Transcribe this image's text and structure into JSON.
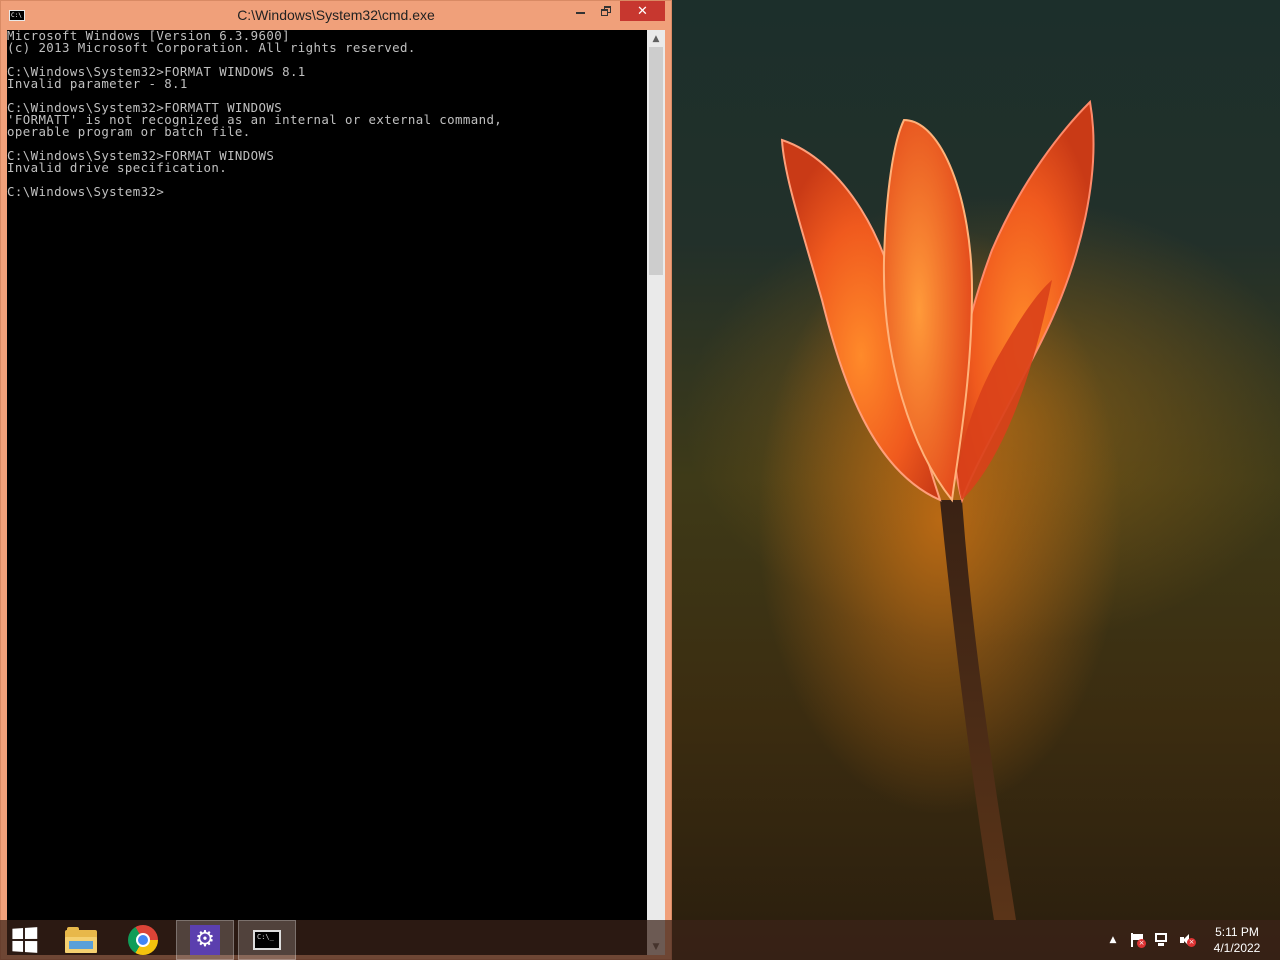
{
  "window": {
    "title": "C:\\Windows\\System32\\cmd.exe",
    "icon_text": "C:\\",
    "minimize_icon": "minimize-icon",
    "restore_icon": "restore-icon",
    "close_label": "✕"
  },
  "console": {
    "lines": [
      "Microsoft Windows [Version 6.3.9600]",
      "(c) 2013 Microsoft Corporation. All rights reserved.",
      "",
      "C:\\Windows\\System32>FORMAT WINDOWS 8.1",
      "Invalid parameter - 8.1",
      "",
      "C:\\Windows\\System32>FORMATT WINDOWS",
      "'FORMATT' is not recognized as an internal or external command,",
      "operable program or batch file.",
      "",
      "C:\\Windows\\System32>FORMAT WINDOWS",
      "Invalid drive specification.",
      "",
      "C:\\Windows\\System32>"
    ],
    "text_color": "#c0c0c0",
    "background": "#000000"
  },
  "scrollbar": {
    "up_arrow": "▲",
    "down_arrow": "▼"
  },
  "taskbar": {
    "items": [
      {
        "name": "start",
        "icon": "windows-logo-icon"
      },
      {
        "name": "file-explorer",
        "icon": "folder-icon"
      },
      {
        "name": "chrome",
        "icon": "chrome-icon"
      },
      {
        "name": "settings",
        "icon": "gear-icon",
        "glyph": "⚙"
      },
      {
        "name": "command-prompt",
        "icon": "cmd-icon",
        "glyph": "C:\\_"
      }
    ],
    "tray": {
      "arrow": "▲",
      "icons": [
        "action-center-flag-icon",
        "network-icon",
        "volume-muted-icon"
      ]
    },
    "clock": {
      "time": "5:11 PM",
      "date": "4/1/2022"
    }
  },
  "colors": {
    "titlebar": "#f0a07a",
    "close_button": "#c7372f",
    "taskbar": "#3c2319",
    "settings_tile": "#5b3fae"
  }
}
